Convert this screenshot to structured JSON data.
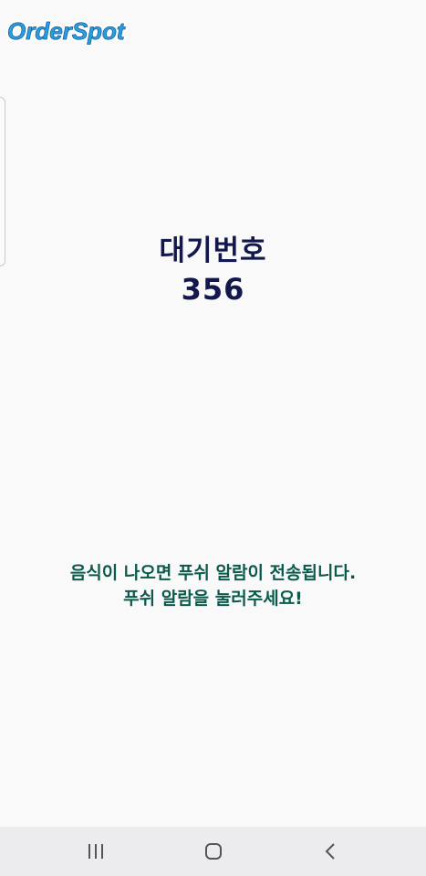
{
  "app": {
    "logo_text_part1": "Order",
    "logo_text_part2": "Spot",
    "brand_color": "#2a9fe0"
  },
  "waiting": {
    "label": "대기번호",
    "number": "356"
  },
  "notice": {
    "line1": "음식이 나오면 푸쉬 알람이 전송됩니다.",
    "line2": "푸쉬 알람을 눌러주세요!"
  },
  "navbar": {
    "recent_icon": "recent-apps-icon",
    "home_icon": "home-icon",
    "back_icon": "back-icon"
  }
}
